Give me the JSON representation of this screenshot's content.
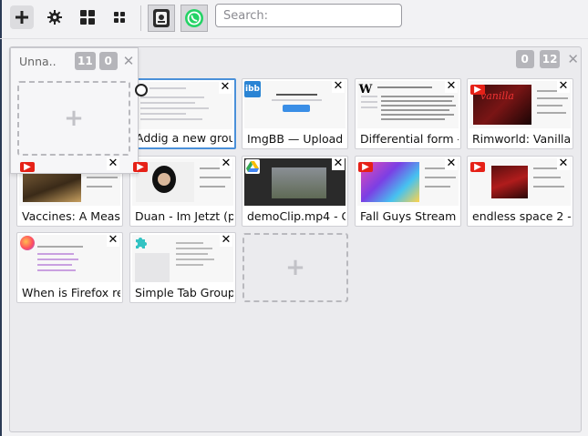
{
  "toolbar": {
    "new_tab_icon": "plus-icon",
    "settings_icon": "gear-icon",
    "layout_large_icon": "grid-large-icon",
    "layout_small_icon": "grid-small-icon",
    "app_icons": [
      "tab-manager-app-icon",
      "whatsapp-app-icon"
    ],
    "search_placeholder": "Search:"
  },
  "group": {
    "title": "Unna..",
    "tab_count": "11",
    "badge_b": "0",
    "close_icon": "close-icon"
  },
  "main": {
    "badge_a": "0",
    "badge_b": "12",
    "close_icon": "close-icon"
  },
  "tabs": [
    {
      "title": "Addig a new grou",
      "favicon": "generic-page-icon",
      "selected": true
    },
    {
      "title": "ImgBB — Upload",
      "favicon": "imgbb-icon"
    },
    {
      "title": "Differential form -",
      "favicon": "wikipedia-icon"
    },
    {
      "title": "Rimworld: Vanilla",
      "favicon": "youtube-icon"
    },
    {
      "title": "Vaccines: A Measu",
      "favicon": "youtube-icon"
    },
    {
      "title": "Duan - Im Jetzt (p",
      "favicon": "youtube-icon"
    },
    {
      "title": "demoClip.mp4 - G",
      "favicon": "google-drive-icon"
    },
    {
      "title": "Fall Guys Stream",
      "favicon": "youtube-icon"
    },
    {
      "title": "endless space 2 -",
      "favicon": "youtube-icon"
    },
    {
      "title": "When is Firefox re",
      "favicon": "firefox-icon"
    },
    {
      "title": "Simple Tab Group",
      "favicon": "puzzle-icon"
    }
  ],
  "colors": {
    "selected_border": "#4a90d9",
    "youtube": "#e62117",
    "imgbb": "#2a84d4",
    "badge": "#b5b5ba"
  }
}
